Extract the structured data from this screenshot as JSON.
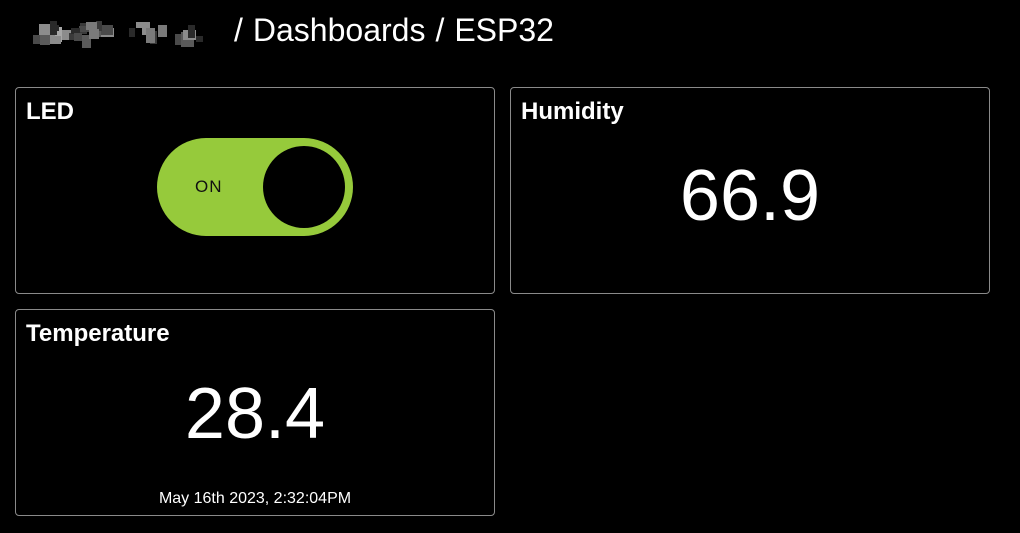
{
  "breadcrumb": {
    "user": "",
    "separator": "/",
    "dashboards": "Dashboards",
    "device": "ESP32"
  },
  "cards": {
    "led": {
      "title": "LED",
      "state_label": "ON",
      "is_on": true
    },
    "humidity": {
      "title": "Humidity",
      "value": "66.9"
    },
    "temperature": {
      "title": "Temperature",
      "value": "28.4",
      "timestamp": "May 16th 2023, 2:32:04PM"
    }
  },
  "colors": {
    "background": "#000000",
    "text": "#ffffff",
    "card_border": "#8a8a8a",
    "toggle_on": "#96ca3b",
    "toggle_knob": "#000000"
  }
}
